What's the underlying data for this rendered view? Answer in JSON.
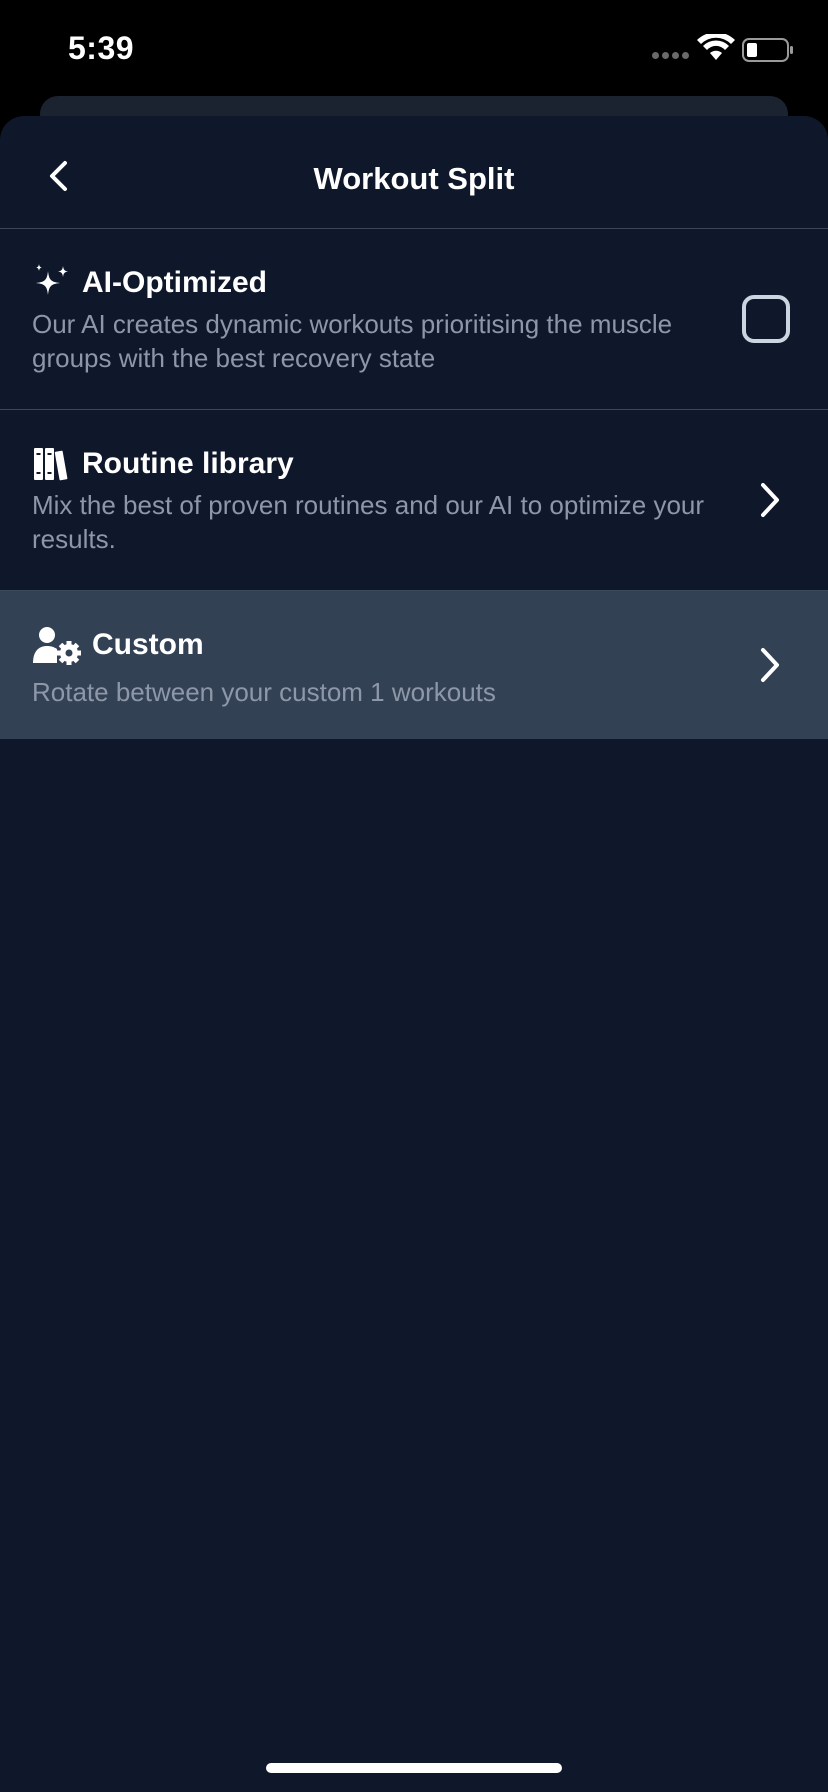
{
  "status_bar": {
    "time": "5:39"
  },
  "nav": {
    "title": "Workout Split"
  },
  "options": [
    {
      "title": "AI-Optimized",
      "description": "Our AI creates dynamic workouts prioritising the muscle groups with the best recovery state",
      "icon": "sparkles-icon",
      "control": "checkbox",
      "checked": false
    },
    {
      "title": "Routine library",
      "description": "Mix the best of proven routines and our AI to optimize your results.",
      "icon": "books-icon",
      "control": "chevron-right"
    },
    {
      "title": "Custom",
      "description": "Rotate between your custom 1 workouts",
      "icon": "user-gear-icon",
      "control": "chevron-right",
      "selected": true
    }
  ],
  "colors": {
    "sheet_bg": "#0f172a",
    "selected_bg": "#334155",
    "divider": "#3b475a",
    "description_text": "#8d97a8"
  }
}
